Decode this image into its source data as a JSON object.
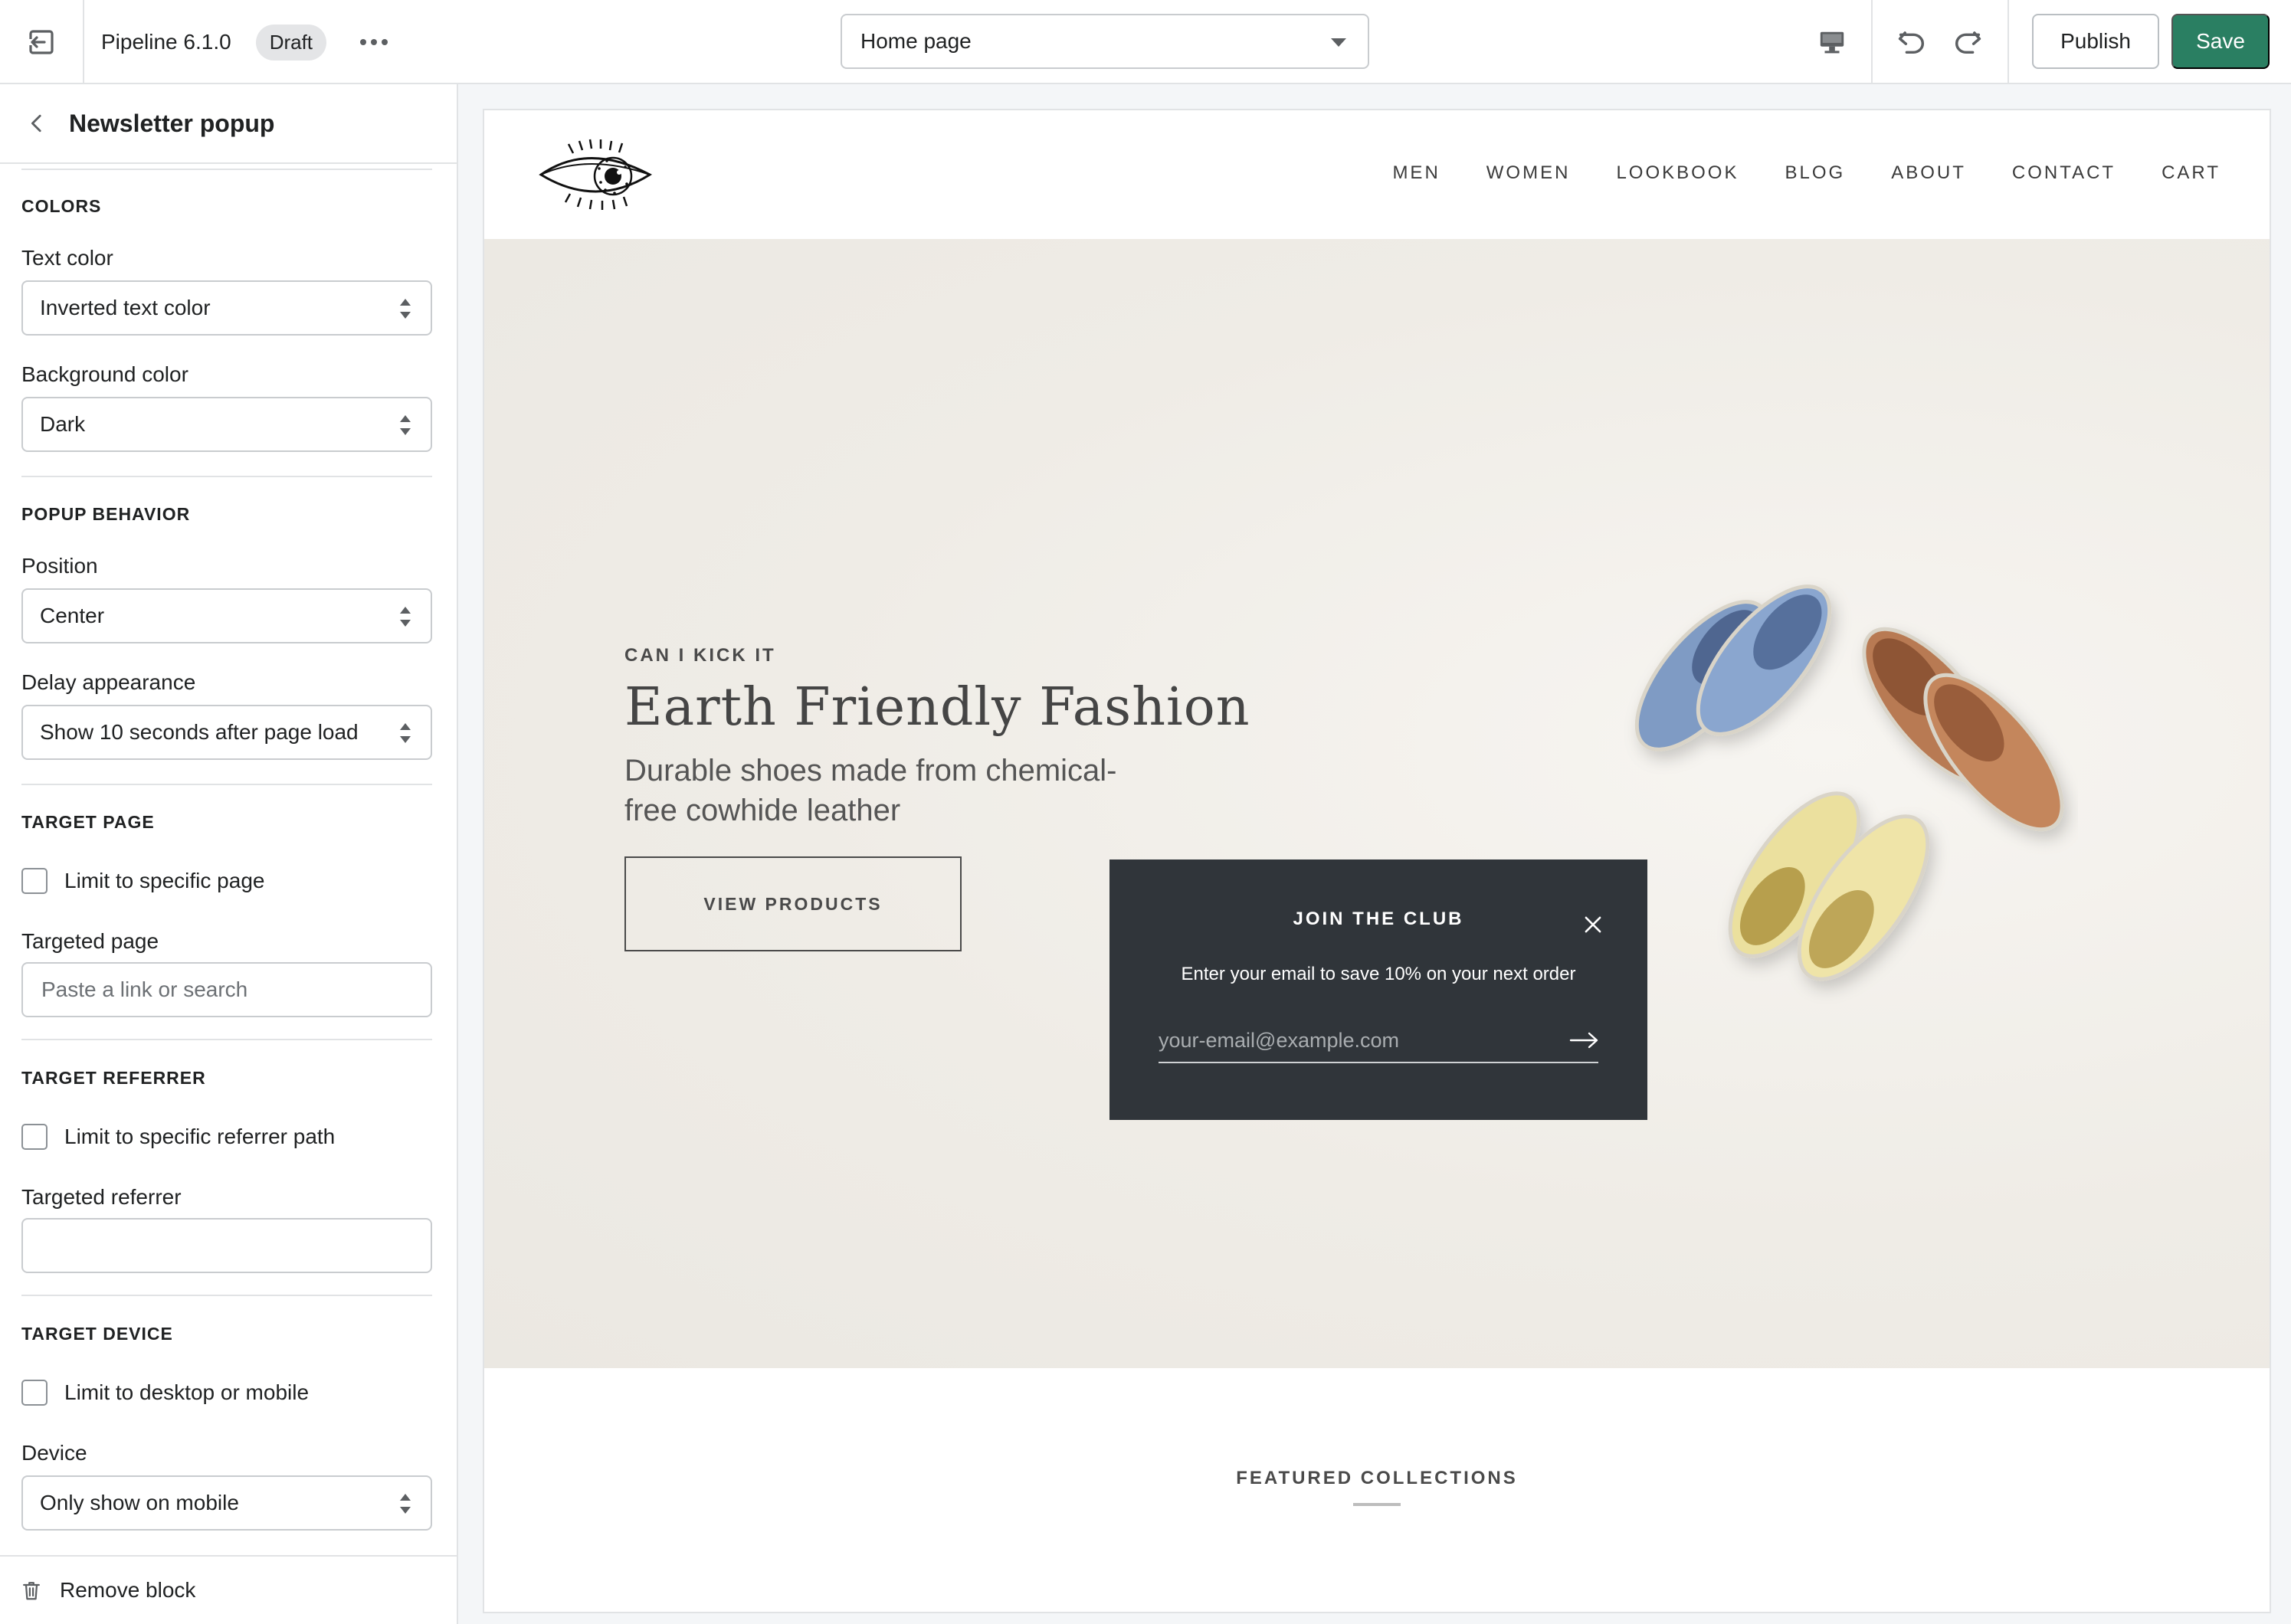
{
  "topbar": {
    "theme_name": "Pipeline 6.1.0",
    "badge": "Draft",
    "page_selector": "Home page",
    "publish_label": "Publish",
    "save_label": "Save",
    "icons": [
      "exit-icon",
      "more-icon",
      "desktop-icon",
      "undo-icon",
      "redo-icon"
    ]
  },
  "sidebar": {
    "title": "Newsletter popup",
    "colors": {
      "section": "COLORS",
      "text_color_label": "Text color",
      "text_color_value": "Inverted text color",
      "bg_color_label": "Background color",
      "bg_color_value": "Dark"
    },
    "behavior": {
      "section": "POPUP BEHAVIOR",
      "position_label": "Position",
      "position_value": "Center",
      "delay_label": "Delay appearance",
      "delay_value": "Show 10 seconds after page load"
    },
    "target_page": {
      "section": "TARGET PAGE",
      "checkbox_label": "Limit to specific page",
      "field_label": "Targeted page",
      "field_placeholder": "Paste a link or search"
    },
    "target_referrer": {
      "section": "TARGET REFERRER",
      "checkbox_label": "Limit to specific referrer path",
      "field_label": "Targeted referrer",
      "field_value": ""
    },
    "target_device": {
      "section": "TARGET DEVICE",
      "checkbox_label": "Limit to desktop or mobile",
      "field_label": "Device",
      "field_value": "Only show on mobile"
    },
    "remove_label": "Remove block"
  },
  "store": {
    "nav": [
      "MEN",
      "WOMEN",
      "LOOKBOOK",
      "BLOG",
      "ABOUT",
      "CONTACT",
      "CART"
    ],
    "hero": {
      "eyebrow": "CAN I KICK IT",
      "title": "Earth Friendly Fashion",
      "subtitle": "Durable shoes made from chemical-free cowhide leather",
      "cta": "VIEW PRODUCTS"
    },
    "popup": {
      "title": "JOIN THE CLUB",
      "text": "Enter your email to save 10% on your next order",
      "email_placeholder": "your-email@example.com",
      "bg_color": "#30353a"
    },
    "featured_title": "FEATURED COLLECTIONS"
  },
  "colors": {
    "accent": "#2a7f62",
    "hero_bg": "#efece6"
  }
}
